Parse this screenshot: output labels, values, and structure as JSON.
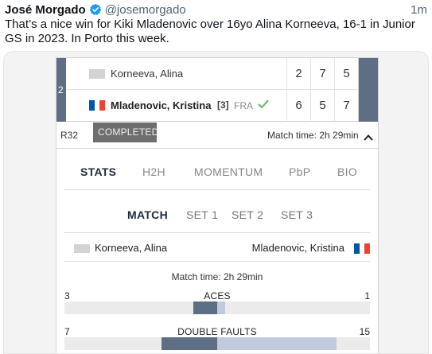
{
  "tweet": {
    "author_name": "José Morgado",
    "handle": "@josemorgado",
    "timestamp": "1m",
    "text": "That’s a nice win for Kiki Mladenovic over 16yo Alina Korneeva, 16-1 in Junior GS in 2023. In Porto this week."
  },
  "colors": {
    "accent_dark": "#5d6e85",
    "accent_light": "#c2cbdd",
    "verified_blue": "#1d9bf0",
    "win_check": "#5cb85c",
    "flag_blue": "#0055a4",
    "flag_red": "#ef4135"
  },
  "scoreboard": {
    "seed_number": "2",
    "players": [
      {
        "name": "Korneeva, Alina",
        "seed": "",
        "country": "",
        "flag": "grey-flag",
        "winner": false,
        "scores": [
          "2",
          "7",
          "5"
        ]
      },
      {
        "name": "Mladenovic, Kristina",
        "seed": "[3]",
        "country": "FRA",
        "flag": "france-flag",
        "winner": true,
        "scores": [
          "6",
          "5",
          "7"
        ]
      }
    ],
    "round": "R32",
    "status": "COMPLETED",
    "match_time": "Match time: 2h 29min"
  },
  "stats_panel": {
    "main_tabs": [
      "STATS",
      "H2H",
      "MOMENTUM",
      "PbP",
      "BIO"
    ],
    "active_main_tab": "STATS",
    "sub_tabs": [
      "MATCH",
      "SET 1",
      "SET 2",
      "SET 3"
    ],
    "active_sub_tab": "MATCH",
    "left_player": "Korneeva, Alina",
    "right_player": "Mladenovic, Kristina",
    "match_time": "Match time: 2h 29min",
    "stats": [
      {
        "label": "ACES",
        "left": "3",
        "right": "1",
        "left_value": 3,
        "right_value": 1
      },
      {
        "label": "DOUBLE FAULTS",
        "left": "7",
        "right": "15",
        "left_value": 7,
        "right_value": 15
      }
    ]
  }
}
